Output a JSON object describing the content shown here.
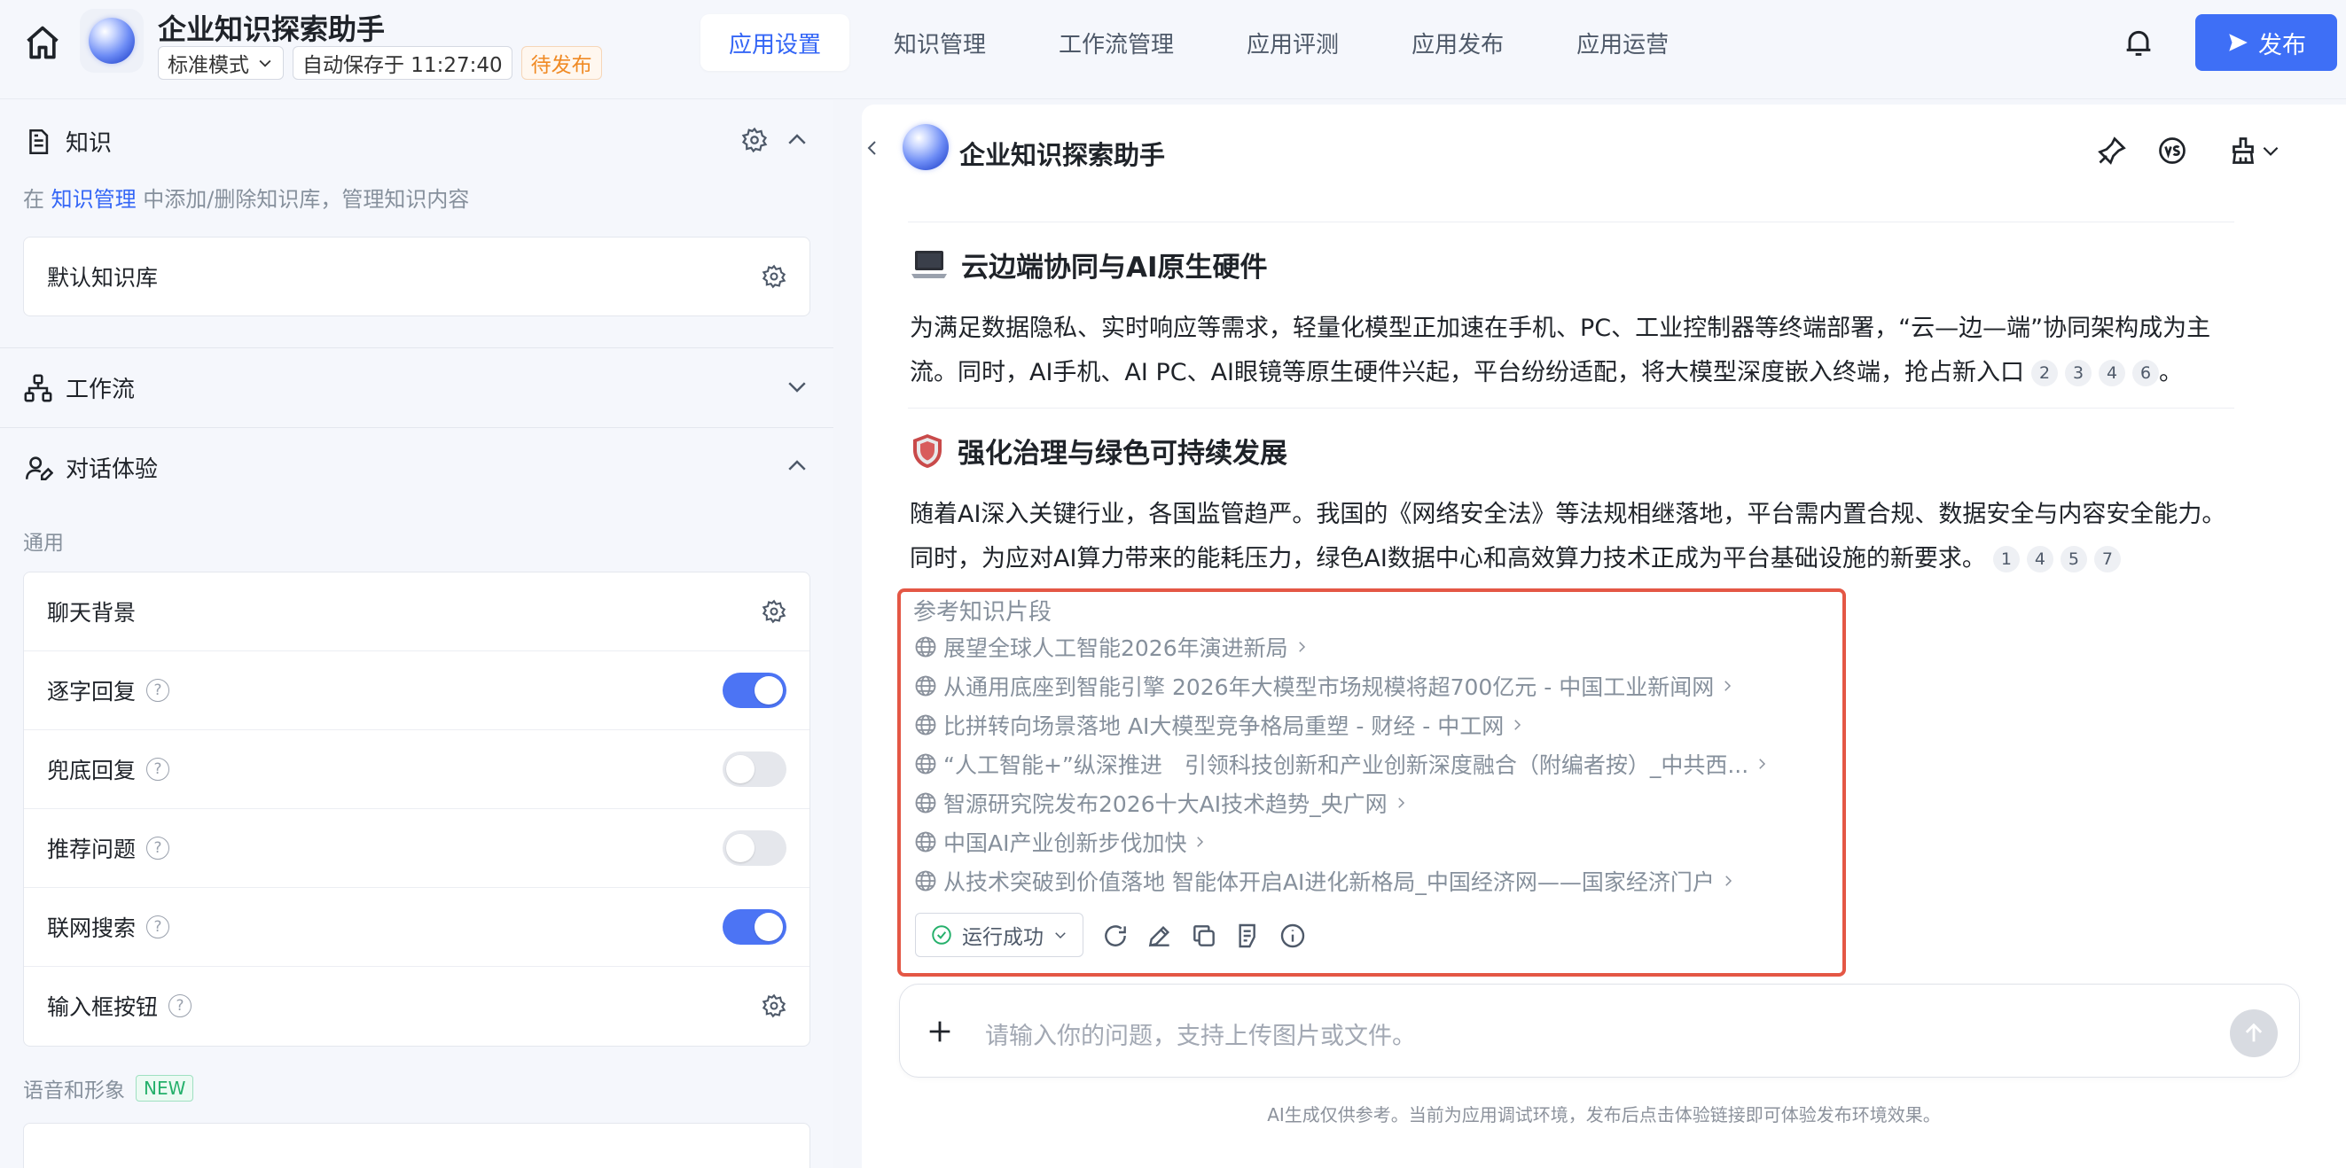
{
  "header": {
    "app_title": "企业知识探索助手",
    "mode": "标准模式",
    "autosave": "自动保存于 11:27:40",
    "status": "待发布",
    "tabs": [
      "应用设置",
      "知识管理",
      "工作流管理",
      "应用评测",
      "应用发布",
      "应用运营"
    ],
    "active_tab": "应用设置",
    "publish_label": "发布"
  },
  "left": {
    "knowledge": {
      "title": "知识",
      "hint_prefix": "在 ",
      "hint_link": "知识管理",
      "hint_suffix": " 中添加/删除知识库，管理知识内容",
      "default_kb": "默认知识库"
    },
    "workflow": {
      "title": "工作流"
    },
    "dialog": {
      "title": "对话体验",
      "general_label": "通用",
      "items": [
        {
          "label": "聊天背景",
          "control": "gear"
        },
        {
          "label": "逐字回复",
          "control": "toggle",
          "on": true,
          "help": true
        },
        {
          "label": "兜底回复",
          "control": "toggle",
          "on": false,
          "help": true
        },
        {
          "label": "推荐问题",
          "control": "toggle",
          "on": false,
          "help": true
        },
        {
          "label": "联网搜索",
          "control": "toggle",
          "on": true,
          "help": true
        },
        {
          "label": "输入框按钮",
          "control": "gear",
          "help": true
        }
      ],
      "voice_label": "语音和形象",
      "new_badge": "NEW"
    }
  },
  "chat": {
    "title": "企业知识探索助手",
    "sections": [
      {
        "heading": "云边端协同与AI原生硬件",
        "text": "为满足数据隐私、实时响应等需求，轻量化模型正加速在手机、PC、工业控制器等终端部署，“云—边—端”协同架构成为主流。同时，AI手机、AI PC、AI眼镜等原生硬件兴起，平台纷纷适配，将大模型深度嵌入终端，抢占新入口",
        "citations": [
          "2",
          "3",
          "4",
          "6"
        ],
        "end": "。"
      },
      {
        "heading": "强化治理与绿色可持续发展",
        "text": "随着AI深入关键行业，各国监管趋严。我国的《网络安全法》等法规相继落地，平台需内置合规、数据安全与内容安全能力。同时，为应对AI算力带来的能耗压力，绿色AI数据中心和高效算力技术正成为平台基础设施的新要求。",
        "citations": [
          "1",
          "4",
          "5",
          "7"
        ]
      }
    ],
    "refs_title": "参考知识片段",
    "refs": [
      "展望全球人工智能2026年演进新局",
      "从通用底座到智能引擎 2026年大模型市场规模将超700亿元 - 中国工业新闻网",
      "比拼转向场景落地 AI大模型竞争格局重塑 - 财经 - 中工网",
      "“人工智能+”纵深推进　引领科技创新和产业创新深度融合（附编者按）_中共西...",
      "智源研究院发布2026十大AI技术趋势_央广网",
      "中国AI产业创新步伐加快",
      "从技术突破到价值落地 智能体开启AI进化新格局_中国经济网——国家经济门户"
    ],
    "run_status": "运行成功",
    "input_placeholder": "请输入你的问题，支持上传图片或文件。",
    "footnote": "AI生成仅供参考。当前为应用调试环境，发布后点击体验链接即可体验发布环境效果。"
  },
  "colors": {
    "accent": "#3e6ff6",
    "highlight_border": "#e45745",
    "warn": "#f08a24"
  }
}
